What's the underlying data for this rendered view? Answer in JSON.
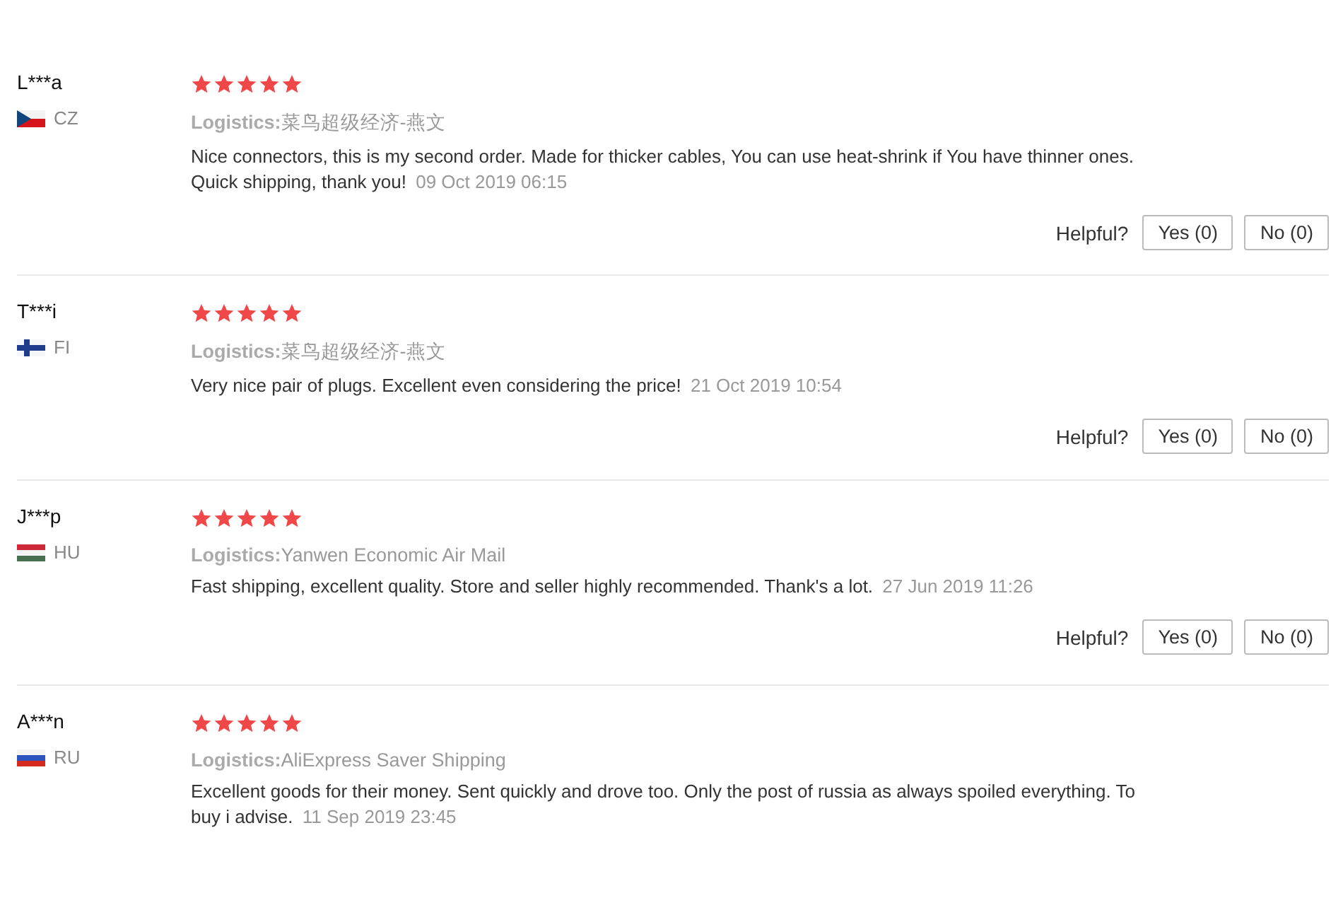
{
  "reviews": [
    {
      "name": "L***a",
      "country": "CZ",
      "kind": "cz",
      "stars": 5,
      "logistics_label": "Logistics:",
      "logistics": "菜鸟超级经济-燕文",
      "text": "Nice connectors, this is my second order. Made for thicker cables, You can use heat-shrink if You have thinner ones. Quick shipping, thank you!",
      "date": "09 Oct 2019 06:15",
      "helpful": {
        "label": "Helpful?",
        "yes": "Yes (0)",
        "no": "No (0)"
      }
    },
    {
      "name": "T***i",
      "country": "FI",
      "kind": "fi",
      "stars": 5,
      "logistics_label": "Logistics:",
      "logistics": "菜鸟超级经济-燕文",
      "text": "Very nice pair of plugs. Excellent even considering the price!",
      "date": "21 Oct 2019 10:54",
      "helpful": {
        "label": "Helpful?",
        "yes": "Yes (0)",
        "no": "No (0)"
      }
    },
    {
      "name": "J***p",
      "country": "HU",
      "kind": "hu",
      "stars": 5,
      "logistics_label": "Logistics:",
      "logistics": "Yanwen Economic Air Mail",
      "text": "Fast shipping, excellent quality. Store and seller highly recommended. Thank's a lot.",
      "date": "27 Jun 2019 11:26",
      "helpful": {
        "label": "Helpful?",
        "yes": "Yes (0)",
        "no": "No (0)"
      }
    },
    {
      "name": "A***n",
      "country": "RU",
      "kind": "ru",
      "stars": 5,
      "logistics_label": "Logistics:",
      "logistics": "AliExpress Saver Shipping",
      "text": "Excellent goods for their money. Sent quickly and drove too. Only the post of russia as always spoiled everything. To buy i advise.",
      "date": "11 Sep 2019 23:45"
    }
  ]
}
